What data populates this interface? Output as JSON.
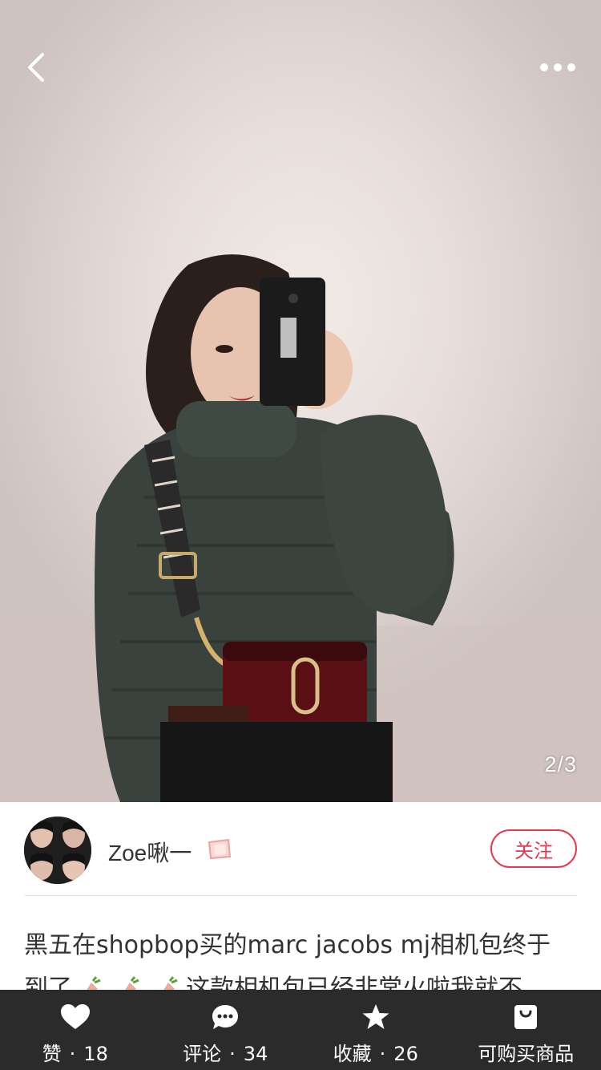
{
  "photo": {
    "page_indicator": "2/3",
    "icons": {
      "back": "chevron-left-icon",
      "more": "more-dots-icon"
    }
  },
  "author": {
    "name": "Zoe啾一",
    "badge_icon": "level-badge-icon",
    "follow_label": "关注"
  },
  "post": {
    "line1": "黑五在shopbop买的marc jacobs mj相机包终于",
    "line2_prefix": "到了",
    "line2_suffix": "这款相机包已经非常火啦我就不"
  },
  "bottom_bar": {
    "items": [
      {
        "label": "赞",
        "count": "18",
        "icon": "heart-icon"
      },
      {
        "label": "评论",
        "count": "34",
        "icon": "comment-icon"
      },
      {
        "label": "收藏",
        "count": "26",
        "icon": "star-icon"
      },
      {
        "label": "可购买商品",
        "icon": "shopping-bag-icon"
      }
    ]
  },
  "colors": {
    "accent": "#e8384f",
    "bar_bg": "#2b2b2b"
  }
}
